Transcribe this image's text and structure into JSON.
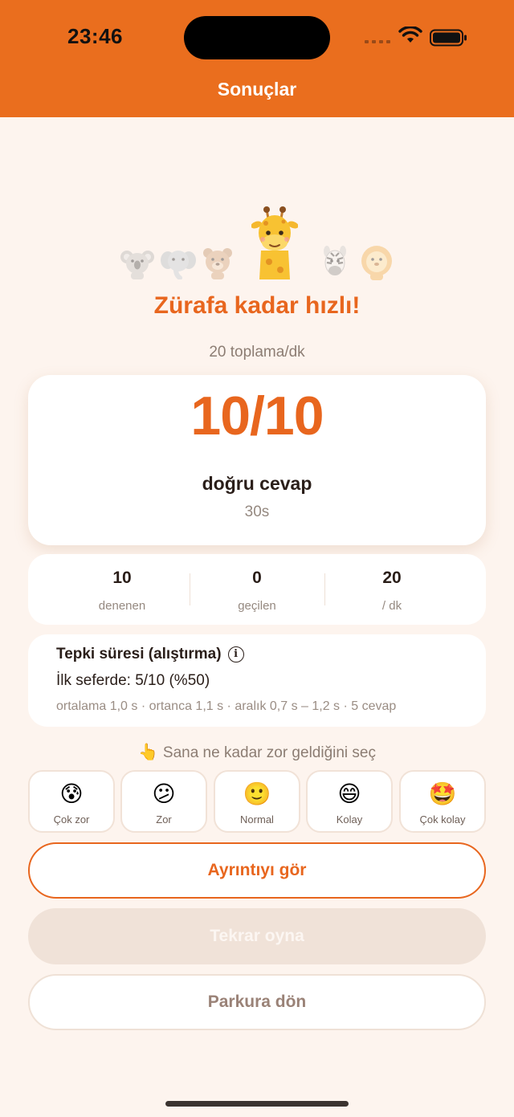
{
  "status_bar": {
    "time": "23:46"
  },
  "header": {
    "title": "Sonuçlar"
  },
  "result": {
    "title": "Zürafa kadar hızlı!",
    "rate": "20 toplama/dk"
  },
  "score": {
    "value": "10/10",
    "label": "doğru cevap",
    "time": "30s"
  },
  "stats": [
    {
      "value": "10",
      "label": "denenen"
    },
    {
      "value": "0",
      "label": "geçilen"
    },
    {
      "value": "20",
      "label": "/ dk"
    }
  ],
  "reaction": {
    "title": "Tepki süresi (alıştırma)",
    "info_icon": "info-icon",
    "first_try": "İlk seferde: 5/10 (%50)",
    "detail": "ortalama 1,0 s · ortanca 1,1 s · aralık 0,7 s – 1,2 s · 5 cevap"
  },
  "difficulty": {
    "prompt": "Sana ne kadar zor geldiğini seç",
    "prompt_icon": "👆",
    "options": [
      {
        "emoji": "😰",
        "label": "Çok zor"
      },
      {
        "emoji": "😕",
        "label": "Zor"
      },
      {
        "emoji": "🙂",
        "label": "Normal"
      },
      {
        "emoji": "😄",
        "label": "Kolay"
      },
      {
        "emoji": "🤩",
        "label": "Çok kolay"
      }
    ]
  },
  "buttons": {
    "details": "Ayrıntıyı gör",
    "replay": "Tekrar oyna",
    "back": "Parkura dön"
  },
  "colors": {
    "accent": "#ea6e1e",
    "background": "#fdf4ee",
    "text": "#2a1e19",
    "muted": "#958980"
  },
  "animals": [
    "koala-icon",
    "elephant-icon",
    "bear-icon",
    "giraffe-icon",
    "zebra-icon",
    "lion-icon"
  ]
}
